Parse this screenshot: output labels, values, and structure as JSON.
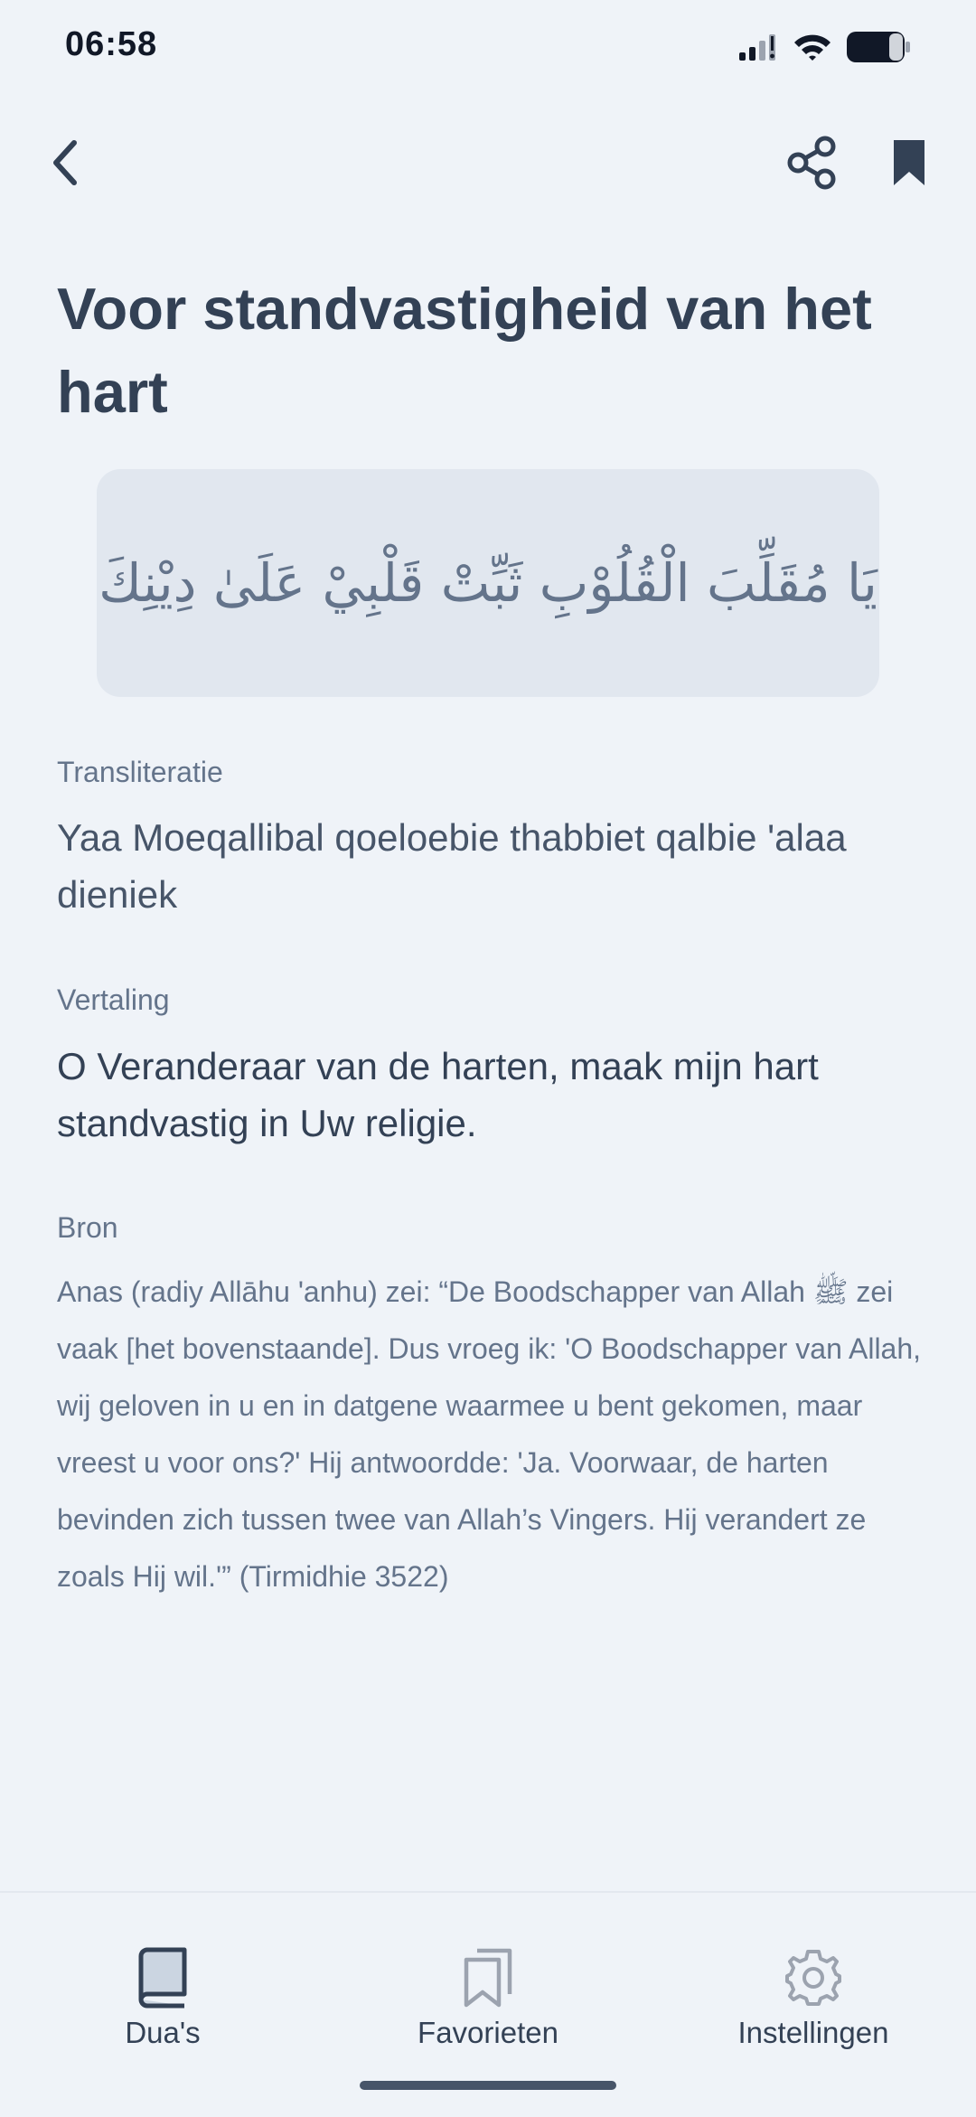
{
  "status_bar": {
    "time": "06:58"
  },
  "header": {
    "icons": [
      "back-icon",
      "share-icon",
      "bookmark-icon"
    ]
  },
  "dua": {
    "title": "Voor standvastigheid van het hart",
    "arabic": "يَا مُقَلِّبَ الْقُلُوْبِ ثَبِّتْ قَلْبِيْ عَلَىٰ دِيْنِكَ",
    "transliteration_label": "Transliteratie",
    "transliteration": "Yaa Moeqallibal qoeloebie thabbiet qalbie ʹalaa dieniek",
    "translation_label": "Vertaling",
    "translation": "O Veranderaar van de harten, maak mijn hart standvastig in Uw religie.",
    "source_label": "Bron",
    "source": "Anas (radiy Allāhu ʹanhu) zei: “De Boodschapper van Allah ﷺ zei vaak [het bovenstaande]. Dus vroeg ik: ʹO Boodschapper van Allah, wij geloven in u en in datgene waarmee u bent gekomen, maar vreest u voor ons?ʹ Hij antwoordde: ʹJa. Voorwaar, de harten bevinden zich tussen twee van Allah’s Vingers. Hij verandert ze zoals Hij wil.ʹ” (Tirmidhie 3522)"
  },
  "bottom_nav": {
    "items": [
      {
        "label": "Dua's",
        "icon": "book-icon",
        "active": true
      },
      {
        "label": "Favorieten",
        "icon": "bookmarks-icon",
        "active": false
      },
      {
        "label": "Instellingen",
        "icon": "gear-icon",
        "active": false
      }
    ]
  },
  "colors": {
    "background": "#eff3f8",
    "card": "#e1e7ef",
    "text_primary": "#334155",
    "text_secondary": "#64748b"
  }
}
